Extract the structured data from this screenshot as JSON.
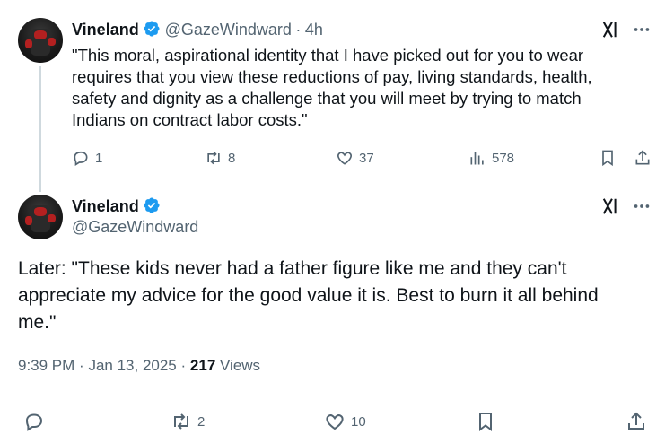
{
  "reply_tweet": {
    "author_name": "Vineland",
    "author_handle": "@GazeWindward",
    "separator": "·",
    "time": "4h",
    "text_lines": [
      "\"This moral, aspirational identity that I have picked out for you to wear",
      "requires that you view these reductions of pay, living standards, health,",
      "safety and dignity as a challenge that you will meet by trying to match",
      "Indians on contract labor costs.\""
    ],
    "stats": {
      "replies": "1",
      "reposts": "8",
      "likes": "37",
      "views": "578"
    }
  },
  "main_tweet": {
    "author_name": "Vineland",
    "author_handle": "@GazeWindward",
    "text_lines": [
      "Later: \"These kids never had a father figure like me and they can't",
      "appreciate my advice for the good value it is. Best to burn it all behind",
      "me.\""
    ],
    "time": "9:39 PM",
    "dot": "·",
    "date": "Jan 13, 2025",
    "views_count": "217",
    "views_label": "Views",
    "stats": {
      "replies": "",
      "reposts": "2",
      "likes": "10"
    }
  },
  "colors": {
    "verified": "#1d9bf0",
    "muted": "#536471",
    "thread_line": "#cfd9de"
  },
  "icons": [
    "verified-badge-icon",
    "grok-icon",
    "more-icon",
    "reply-icon",
    "repost-icon",
    "like-icon",
    "views-icon",
    "bookmark-icon",
    "share-icon"
  ]
}
